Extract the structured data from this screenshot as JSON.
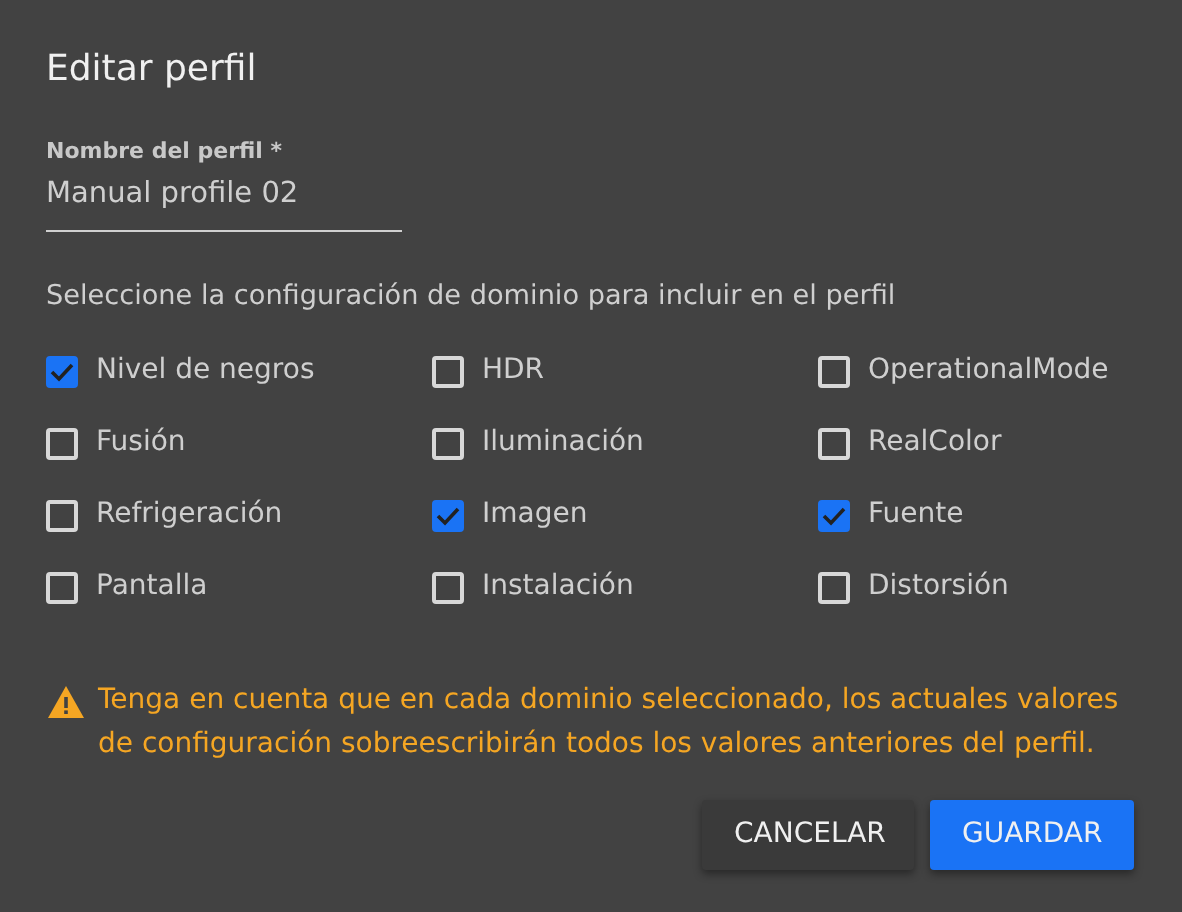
{
  "dialog": {
    "title": "Editar perfil",
    "name_field": {
      "label": "Nombre del perfil *",
      "value": "Manual profile 02"
    },
    "instruction": "Seleccione la configuración de dominio para incluir en el perfil",
    "domains": [
      {
        "label": "Nivel de negros",
        "checked": true
      },
      {
        "label": "HDR",
        "checked": false
      },
      {
        "label": "OperationalMode",
        "checked": false
      },
      {
        "label": "Fusión",
        "checked": false
      },
      {
        "label": "Iluminación",
        "checked": false
      },
      {
        "label": "RealColor",
        "checked": false
      },
      {
        "label": "Refrigeración",
        "checked": false
      },
      {
        "label": "Imagen",
        "checked": true
      },
      {
        "label": "Fuente",
        "checked": true
      },
      {
        "label": "Pantalla",
        "checked": false
      },
      {
        "label": "Instalación",
        "checked": false
      },
      {
        "label": "Distorsión",
        "checked": false
      }
    ],
    "warning": "Tenga en cuenta que en cada dominio seleccionado, los actuales valores de configuración sobreescribirán todos los valores anteriores del perfil.",
    "buttons": [
      {
        "label": "CANCELAR",
        "kind": "secondary"
      },
      {
        "label": "GUARDAR",
        "kind": "primary"
      }
    ]
  }
}
